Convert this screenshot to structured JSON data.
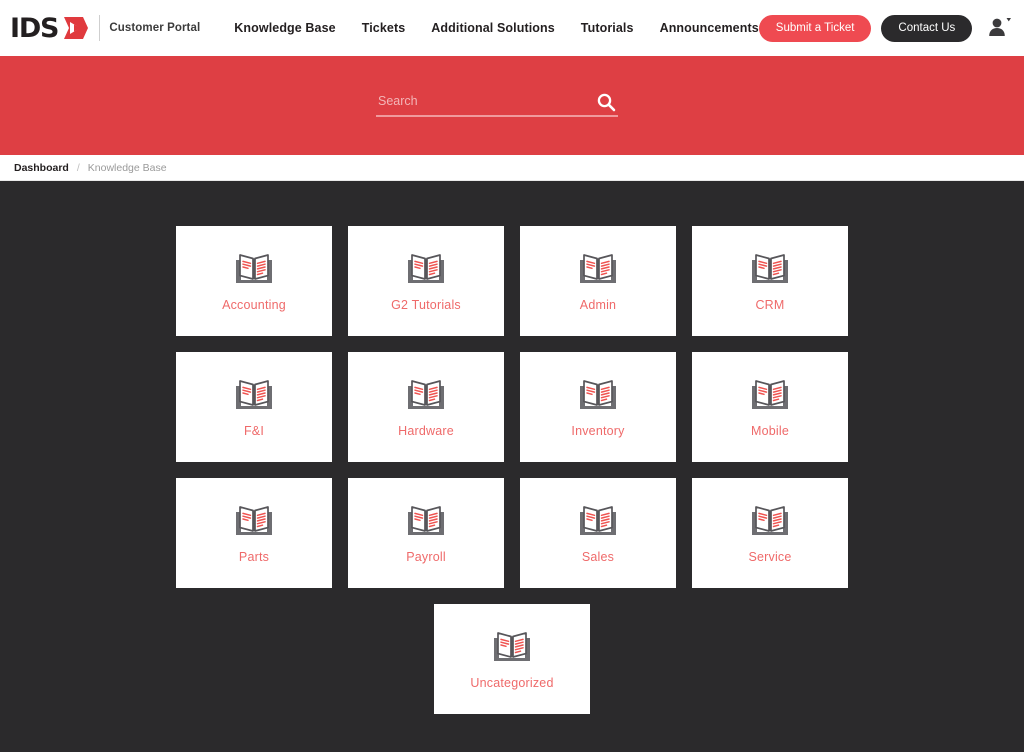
{
  "header": {
    "logo_text": "IDS",
    "logo_mark": "ids-arrow-logo",
    "sub_brand": "Customer Portal",
    "nav_items": [
      {
        "label": "Knowledge Base",
        "name": "nav-knowledge-base"
      },
      {
        "label": "Tickets",
        "name": "nav-tickets"
      },
      {
        "label": "Additional Solutions",
        "name": "nav-additional-solutions"
      },
      {
        "label": "Tutorials",
        "name": "nav-tutorials"
      },
      {
        "label": "Announcements",
        "name": "nav-announcements"
      }
    ],
    "submit_ticket_label": "Submit a Ticket",
    "contact_us_label": "Contact Us",
    "account_icon": "user-avatar-icon"
  },
  "search": {
    "placeholder": "Search",
    "value": "",
    "icon": "search-icon"
  },
  "breadcrumb": {
    "root": "Dashboard",
    "separator": "/",
    "current": "Knowledge Base"
  },
  "categories": [
    {
      "label": "Accounting",
      "icon": "open-book-icon"
    },
    {
      "label": "G2 Tutorials",
      "icon": "open-book-icon"
    },
    {
      "label": "Admin",
      "icon": "open-book-icon"
    },
    {
      "label": "CRM",
      "icon": "open-book-icon"
    },
    {
      "label": "F&I",
      "icon": "open-book-icon"
    },
    {
      "label": "Hardware",
      "icon": "open-book-icon"
    },
    {
      "label": "Inventory",
      "icon": "open-book-icon"
    },
    {
      "label": "Mobile",
      "icon": "open-book-icon"
    },
    {
      "label": "Parts",
      "icon": "open-book-icon"
    },
    {
      "label": "Payroll",
      "icon": "open-book-icon"
    },
    {
      "label": "Sales",
      "icon": "open-book-icon"
    },
    {
      "label": "Service",
      "icon": "open-book-icon"
    },
    {
      "label": "Uncategorized",
      "icon": "open-book-icon"
    }
  ],
  "colors": {
    "brand_red": "#de3f44",
    "accent_red": "#ef4a51",
    "label_red": "#ef6a6a",
    "dark_bg": "#2b2a2c",
    "card_bg": "#ffffff"
  }
}
